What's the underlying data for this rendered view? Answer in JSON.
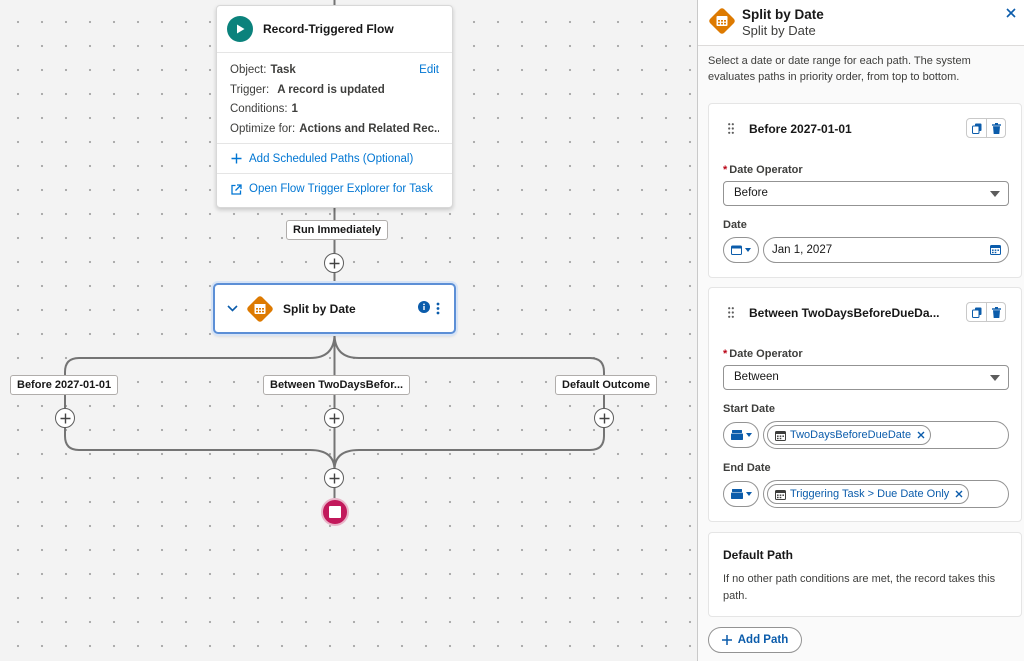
{
  "colors": {
    "accent": "#0176d3",
    "flow_start": "#0b827c",
    "decision": "#dd7a01",
    "end": "#c2185b",
    "selected_border": "#5c8fd6"
  },
  "canvas": {
    "trigger_card": {
      "title": "Record-Triggered Flow",
      "icon": "play-icon",
      "object_label": "Object:",
      "object_value": "Task",
      "edit_label": "Edit",
      "trigger_label": "Trigger:",
      "trigger_value": "A record is updated",
      "conditions_label": "Conditions:",
      "conditions_value": "1",
      "optimize_label": "Optimize for:",
      "optimize_value": "Actions and Related Rec...",
      "add_scheduled_paths": "Add Scheduled Paths (Optional)",
      "open_explorer": "Open Flow Trigger Explorer for Task"
    },
    "run_immediately": "Run Immediately",
    "decision_node": {
      "label": "Split by Date",
      "icon": "calendar-decision-icon"
    },
    "branches": [
      {
        "label": "Before 2027-01-01"
      },
      {
        "label": "Between TwoDaysBefor..."
      },
      {
        "label": "Default Outcome"
      }
    ]
  },
  "panel": {
    "title": "Split by Date",
    "subtitle": "Split by Date",
    "description": "Select a date or date range for each path. The system evaluates paths in priority order, from top to bottom.",
    "paths": [
      {
        "title": "Before 2027-01-01",
        "date_operator_label": "Date Operator",
        "date_operator_value": "Before",
        "date_label": "Date",
        "date_value": "Jan 1, 2027"
      },
      {
        "title": "Between TwoDaysBeforeDueDa...",
        "date_operator_label": "Date Operator",
        "date_operator_value": "Between",
        "start_date_label": "Start Date",
        "start_date_value": "TwoDaysBeforeDueDate",
        "end_date_label": "End Date",
        "end_date_value": "Triggering Task > Due Date Only"
      }
    ],
    "default_path": {
      "title": "Default Path",
      "text": "If no other path conditions are met, the record takes this path."
    },
    "add_path_label": "Add Path"
  }
}
